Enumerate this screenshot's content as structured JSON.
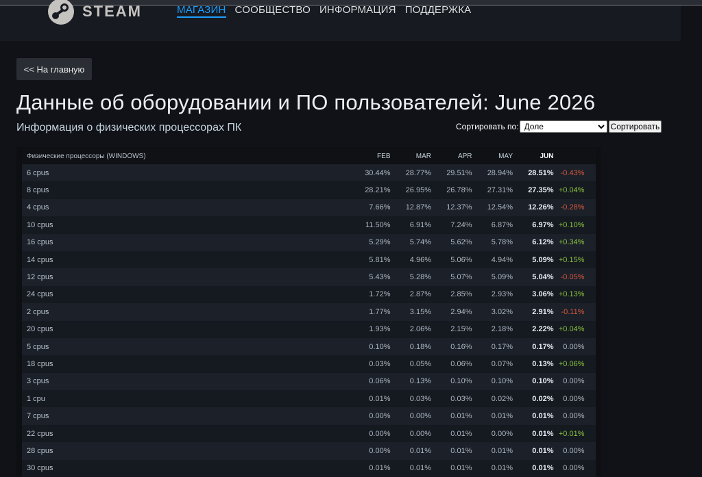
{
  "header": {
    "logo_text": "STEAM",
    "nav": [
      "МАГАЗИН",
      "СООБЩЕСТВО",
      "ИНФОРМАЦИЯ",
      "ПОДДЕРЖКА"
    ]
  },
  "back_label": "<< На главную",
  "title": "Данные об оборудовании и ПО пользователей: June 2026",
  "subtitle": "Информация о физических процессорах ПК",
  "sort": {
    "label": "Сортировать по:",
    "selected": "Доле",
    "button": "Сортировать"
  },
  "table": {
    "name_header": "Физические процессоры (WINDOWS)",
    "months": [
      "FEB",
      "MAR",
      "APR",
      "MAY",
      "JUN"
    ],
    "rows": [
      {
        "name": "6 cpus",
        "v": [
          "30.44%",
          "28.77%",
          "29.51%",
          "28.94%",
          "28.51%"
        ],
        "chg": "-0.43%",
        "dir": "neg"
      },
      {
        "name": "8 cpus",
        "v": [
          "28.21%",
          "26.95%",
          "26.78%",
          "27.31%",
          "27.35%"
        ],
        "chg": "+0.04%",
        "dir": "pos"
      },
      {
        "name": "4 cpus",
        "v": [
          "7.66%",
          "12.87%",
          "12.37%",
          "12.54%",
          "12.26%"
        ],
        "chg": "-0.28%",
        "dir": "neg"
      },
      {
        "name": "10 cpus",
        "v": [
          "11.50%",
          "6.91%",
          "7.24%",
          "6.87%",
          "6.97%"
        ],
        "chg": "+0.10%",
        "dir": "pos"
      },
      {
        "name": "16 cpus",
        "v": [
          "5.29%",
          "5.74%",
          "5.62%",
          "5.78%",
          "6.12%"
        ],
        "chg": "+0.34%",
        "dir": "pos"
      },
      {
        "name": "14 cpus",
        "v": [
          "5.81%",
          "4.96%",
          "5.06%",
          "4.94%",
          "5.09%"
        ],
        "chg": "+0.15%",
        "dir": "pos"
      },
      {
        "name": "12 cpus",
        "v": [
          "5.43%",
          "5.28%",
          "5.07%",
          "5.09%",
          "5.04%"
        ],
        "chg": "-0.05%",
        "dir": "neg"
      },
      {
        "name": "24 cpus",
        "v": [
          "1.72%",
          "2.87%",
          "2.85%",
          "2.93%",
          "3.06%"
        ],
        "chg": "+0.13%",
        "dir": "pos"
      },
      {
        "name": "2 cpus",
        "v": [
          "1.77%",
          "3.15%",
          "2.94%",
          "3.02%",
          "2.91%"
        ],
        "chg": "-0.11%",
        "dir": "neg"
      },
      {
        "name": "20 cpus",
        "v": [
          "1.93%",
          "2.06%",
          "2.15%",
          "2.18%",
          "2.22%"
        ],
        "chg": "+0.04%",
        "dir": "pos"
      },
      {
        "name": "5 cpus",
        "v": [
          "0.10%",
          "0.18%",
          "0.16%",
          "0.17%",
          "0.17%"
        ],
        "chg": "0.00%",
        "dir": "zero"
      },
      {
        "name": "18 cpus",
        "v": [
          "0.03%",
          "0.05%",
          "0.06%",
          "0.07%",
          "0.13%"
        ],
        "chg": "+0.06%",
        "dir": "pos"
      },
      {
        "name": "3 cpus",
        "v": [
          "0.06%",
          "0.13%",
          "0.10%",
          "0.10%",
          "0.10%"
        ],
        "chg": "0.00%",
        "dir": "zero"
      },
      {
        "name": "1 cpu",
        "v": [
          "0.01%",
          "0.03%",
          "0.03%",
          "0.02%",
          "0.02%"
        ],
        "chg": "0.00%",
        "dir": "zero"
      },
      {
        "name": "7 cpus",
        "v": [
          "0.00%",
          "0.00%",
          "0.01%",
          "0.01%",
          "0.01%"
        ],
        "chg": "0.00%",
        "dir": "zero"
      },
      {
        "name": "22 cpus",
        "v": [
          "0.00%",
          "0.00%",
          "0.01%",
          "0.00%",
          "0.01%"
        ],
        "chg": "+0.01%",
        "dir": "pos"
      },
      {
        "name": "28 cpus",
        "v": [
          "0.00%",
          "0.01%",
          "0.01%",
          "0.01%",
          "0.01%"
        ],
        "chg": "0.00%",
        "dir": "zero"
      },
      {
        "name": "30 cpus",
        "v": [
          "0.01%",
          "0.01%",
          "0.01%",
          "0.01%",
          "0.01%"
        ],
        "chg": "0.00%",
        "dir": "zero"
      }
    ]
  }
}
